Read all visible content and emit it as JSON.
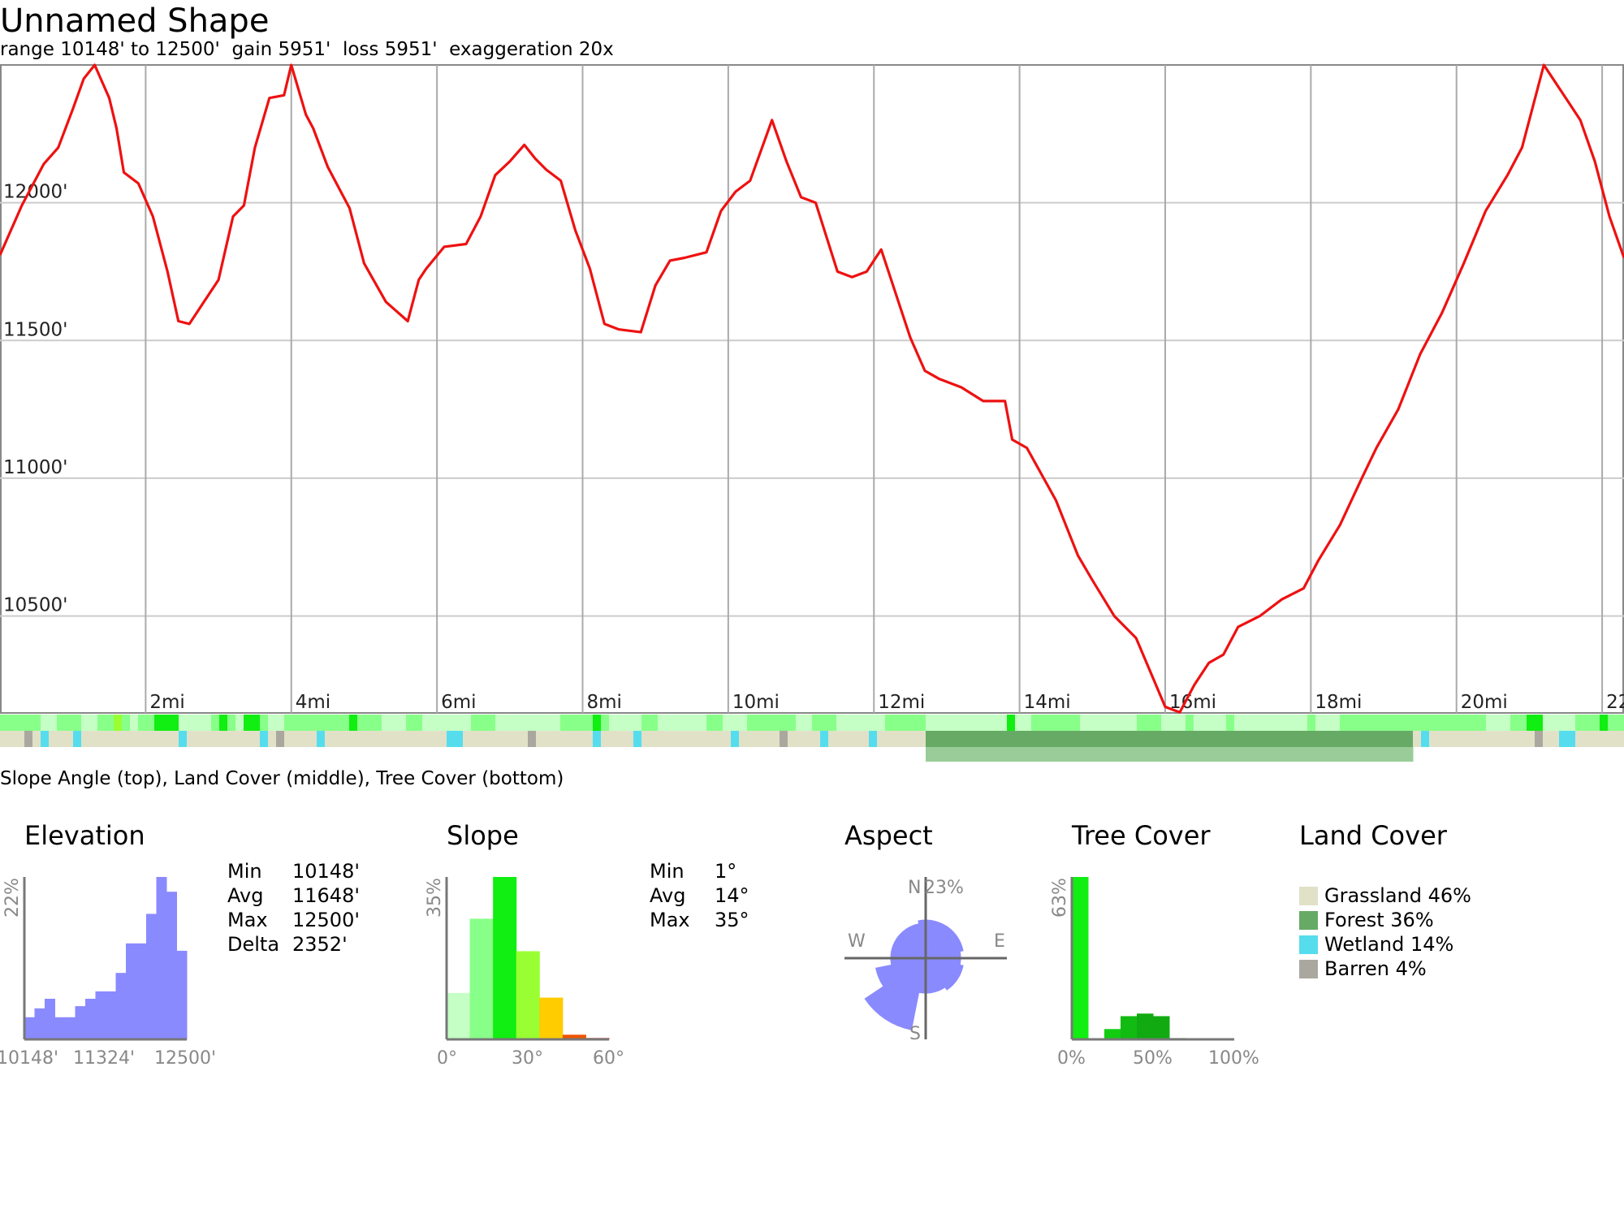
{
  "header": {
    "title": "Unnamed Shape",
    "subtitle": "range 10148' to 12500'  gain 5951'  loss 5951'  exaggeration 20x"
  },
  "chart_data": [
    {
      "type": "line",
      "title": "",
      "xlabel": "",
      "ylabel": "",
      "x_unit": "mi",
      "xlim": [
        0,
        22.3
      ],
      "ylim": [
        10148,
        12500
      ],
      "grid": true,
      "x_ticks": [
        2,
        4,
        6,
        8,
        10,
        12,
        14,
        16,
        18,
        20,
        22
      ],
      "x_tick_labels": [
        "2mi",
        "4mi",
        "6mi",
        "8mi",
        "10mi",
        "12mi",
        "14mi",
        "16mi",
        "18mi",
        "20mi",
        "22mi"
      ],
      "y_ticks": [
        10500,
        11000,
        11500,
        12000
      ],
      "y_tick_labels": [
        "10500'",
        "11000'",
        "11500'",
        "12000'"
      ],
      "series": [
        {
          "color": "#ee1111",
          "x": [
            0.0,
            0.3,
            0.6,
            0.8,
            1.0,
            1.15,
            1.3,
            1.5,
            1.6,
            1.7,
            1.9,
            2.1,
            2.3,
            2.45,
            2.6,
            2.8,
            3.0,
            3.2,
            3.35,
            3.5,
            3.7,
            3.9,
            4.0,
            4.2,
            4.3,
            4.5,
            4.8,
            5.0,
            5.3,
            5.6,
            5.75,
            5.85,
            6.1,
            6.4,
            6.6,
            6.8,
            7.0,
            7.2,
            7.35,
            7.5,
            7.7,
            7.9,
            8.1,
            8.3,
            8.5,
            8.8,
            9.0,
            9.2,
            9.4,
            9.7,
            9.9,
            10.1,
            10.3,
            10.6,
            10.8,
            11.0,
            11.2,
            11.5,
            11.7,
            11.9,
            12.1,
            12.4,
            12.5,
            12.7,
            12.9,
            13.2,
            13.5,
            13.8,
            13.9,
            14.1,
            14.5,
            14.8,
            15.0,
            15.3,
            15.6,
            16.0,
            16.2,
            16.4,
            16.6,
            16.8,
            17.0,
            17.3,
            17.6,
            17.9,
            18.1,
            18.4,
            18.7,
            18.9,
            19.2,
            19.5,
            19.8,
            20.1,
            20.4,
            20.7,
            20.9,
            21.2,
            21.5,
            21.7,
            21.9,
            22.1,
            22.3
          ],
          "y": [
            11810,
            11990,
            12140,
            12200,
            12340,
            12450,
            12500,
            12380,
            12270,
            12110,
            12070,
            11950,
            11750,
            11570,
            11560,
            11640,
            11720,
            11950,
            11990,
            12200,
            12380,
            12390,
            12500,
            12320,
            12270,
            12130,
            11980,
            11780,
            11640,
            11570,
            11720,
            11760,
            11840,
            11850,
            11950,
            12100,
            12150,
            12210,
            12160,
            12120,
            12080,
            11900,
            11760,
            11560,
            11540,
            11530,
            11700,
            11790,
            11800,
            11820,
            11970,
            12040,
            12080,
            12300,
            12150,
            12020,
            12000,
            11750,
            11730,
            11750,
            11830,
            11590,
            11510,
            11390,
            11360,
            11330,
            11280,
            11280,
            11140,
            11110,
            10920,
            10720,
            10630,
            10500,
            10420,
            10170,
            10150,
            10250,
            10330,
            10360,
            10460,
            10500,
            10560,
            10600,
            10700,
            10830,
            11000,
            11110,
            11250,
            11450,
            11600,
            11780,
            11970,
            12100,
            12200,
            12500,
            12380,
            12300,
            12150,
            11950,
            11800
          ]
        }
      ]
    },
    {
      "type": "bar",
      "title": "Elevation",
      "categories": [
        "10148'",
        "10296'",
        "10443'",
        "10590'",
        "10737'",
        "10884'",
        "11031'",
        "11178'",
        "11324'",
        "11471'",
        "11618'",
        "11765'",
        "11912'",
        "12059'",
        "12206'",
        "12353'",
        "12500'"
      ],
      "values": [
        3.0,
        4.2,
        5.5,
        3.0,
        3.0,
        4.5,
        5.5,
        6.5,
        6.5,
        9.0,
        13.0,
        13.0,
        17.0,
        22.0,
        20.0,
        12.0
      ],
      "x_tick_labels": [
        "10148'",
        "11324'",
        "12500'"
      ],
      "y_tick_labels": [
        "22%"
      ],
      "ylim": [
        0,
        22
      ],
      "color": "#8a8aff",
      "stats": [
        {
          "k": "Min",
          "v": "10148'"
        },
        {
          "k": "Avg",
          "v": "11648'"
        },
        {
          "k": "Max",
          "v": "12500'"
        },
        {
          "k": "Delta",
          "v": "2352'"
        }
      ]
    },
    {
      "type": "bar",
      "title": "Slope",
      "categories": [
        "0-5°",
        "5-10°",
        "10-15°",
        "15-20°",
        "20-25°",
        "25-30°",
        "30-35°"
      ],
      "values": [
        10,
        26,
        35,
        19,
        9,
        1,
        0.3
      ],
      "colors": [
        "#c5ffc5",
        "#88ff88",
        "#11ee11",
        "#99ff33",
        "#ffcc00",
        "#ee5500",
        "#cc2200"
      ],
      "x_tick_labels": [
        "0°",
        "30°",
        "60°"
      ],
      "y_tick_labels": [
        "35%"
      ],
      "ylim": [
        0,
        35
      ],
      "stats": [
        {
          "k": "Min",
          "v": "1°"
        },
        {
          "k": "Avg",
          "v": "14°"
        },
        {
          "k": "Max",
          "v": "35°"
        }
      ]
    },
    {
      "type": "pie",
      "title": "Aspect",
      "categories": [
        "N",
        "NNE",
        "NE",
        "ENE",
        "E",
        "ESE",
        "SE",
        "SSE",
        "S",
        "SSW",
        "SW",
        "WSW",
        "W",
        "WNW",
        "NW",
        "NNW"
      ],
      "values": [
        12,
        12,
        12,
        12,
        11,
        12,
        12,
        11,
        11,
        23,
        23,
        16,
        11,
        11,
        11,
        11
      ],
      "max_label": "23%",
      "direction_labels": [
        "N",
        "E",
        "S",
        "W"
      ],
      "color": "#8a8aff"
    },
    {
      "type": "bar",
      "title": "Tree Cover",
      "categories": [
        "0-10%",
        "10-20%",
        "20-30%",
        "30-40%",
        "40-50%",
        "50-60%",
        "60-70%",
        "70-80%",
        "80-90%",
        "90-100%"
      ],
      "values": [
        63,
        0,
        4,
        9,
        10,
        9,
        0.5,
        0,
        0,
        0
      ],
      "colors": [
        "#11ee11",
        "#11dd11",
        "#11cc11",
        "#11bb11",
        "#11aa11",
        "#11aa11",
        "#119911",
        "#119911",
        "#118811",
        "#118811"
      ],
      "x_tick_labels": [
        "0%",
        "50%",
        "100%"
      ],
      "y_tick_labels": [
        "63%"
      ],
      "ylim": [
        0,
        63
      ]
    },
    {
      "type": "pie",
      "title": "Land Cover",
      "categories": [
        "Grassland",
        "Forest",
        "Wetland",
        "Barren"
      ],
      "values": [
        46,
        36,
        14,
        4
      ],
      "labels": [
        "Grassland 46%",
        "Forest 36%",
        "Wetland 14%",
        "Barren 4%"
      ],
      "colors": [
        "#e1e1c8",
        "#66aa66",
        "#55ddee",
        "#aaa89e"
      ]
    }
  ],
  "strips": {
    "label": "Slope Angle (top), Land Cover (middle), Tree Cover (bottom)"
  }
}
